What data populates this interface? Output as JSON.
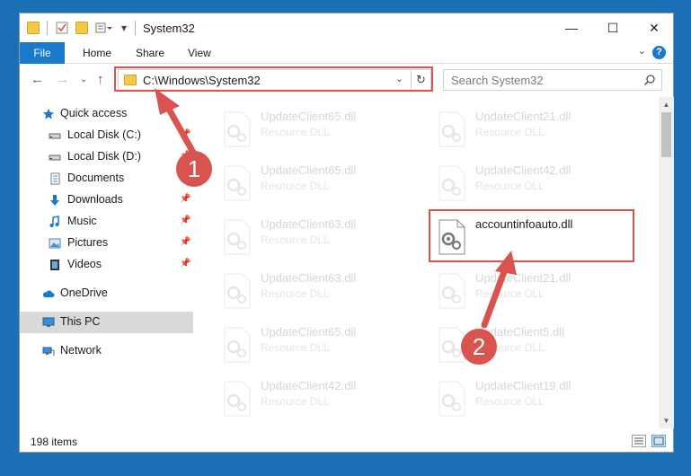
{
  "window": {
    "title": "System32",
    "minimize_icon": "minimize-icon",
    "maximize_icon": "maximize-icon",
    "close_icon": "close-icon"
  },
  "ribbon": {
    "tabs": [
      {
        "label": "File"
      },
      {
        "label": "Home"
      },
      {
        "label": "Share"
      },
      {
        "label": "View"
      }
    ],
    "help_label": "?"
  },
  "address": {
    "path": "C:\\Windows\\System32"
  },
  "search": {
    "placeholder": "Search System32"
  },
  "sidebar": {
    "items": [
      {
        "label": "Quick access",
        "icon": "star-icon"
      },
      {
        "label": "Local Disk (C:)",
        "icon": "drive-icon"
      },
      {
        "label": "Local Disk (D:)",
        "icon": "drive-icon"
      },
      {
        "label": "Documents",
        "icon": "documents-icon"
      },
      {
        "label": "Downloads",
        "icon": "download-arrow-icon"
      },
      {
        "label": "Music",
        "icon": "music-note-icon"
      },
      {
        "label": "Pictures",
        "icon": "pictures-icon"
      },
      {
        "label": "Videos",
        "icon": "film-icon"
      },
      {
        "label": "OneDrive",
        "icon": "cloud-icon"
      },
      {
        "label": "This PC",
        "icon": "monitor-icon"
      },
      {
        "label": "Network",
        "icon": "network-icon"
      }
    ]
  },
  "files": {
    "left_column": [
      {
        "name": "UpdateClient65.dll",
        "type": "Resource DLL"
      },
      {
        "name": "UpdateClient65.dll",
        "type": "Resource DLL"
      },
      {
        "name": "UpdateClient63.dll",
        "type": "Resource DLL"
      },
      {
        "name": "UpdateClient63.dll",
        "type": "Resource DLL"
      },
      {
        "name": "UpdateClient65.dll",
        "type": "Resource DLL"
      },
      {
        "name": "UpdateClient42.dll",
        "type": "Resource DLL"
      }
    ],
    "right_column": [
      {
        "name": "UpdateClient21.dll",
        "type": "Resource DLL"
      },
      {
        "name": "UpdateClient42.dll",
        "type": "Resource DLL"
      },
      {
        "name": "accountinfoauto.dll",
        "type": ""
      },
      {
        "name": "UpdateClient21.dll",
        "type": "Resource DLL"
      },
      {
        "name": "UpdateClient5.dll",
        "type": "Resource DLL"
      },
      {
        "name": "UpdateClient19.dll",
        "type": "Resource DLL"
      }
    ]
  },
  "status": {
    "item_count": "198 items"
  },
  "annotations": {
    "step1": "1",
    "step2": "2",
    "color": "#d9534f"
  }
}
